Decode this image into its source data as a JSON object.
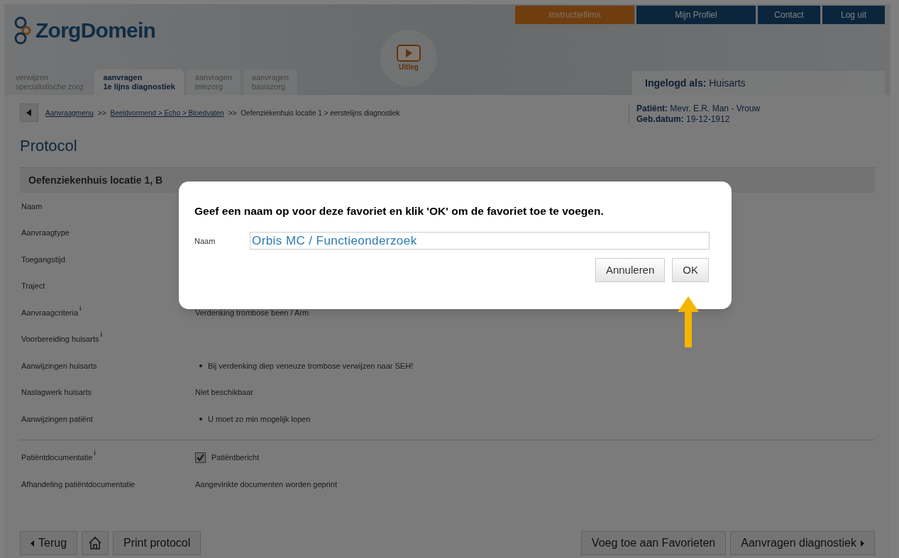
{
  "logo": {
    "text": "ZorgDomein"
  },
  "top_nav": [
    {
      "label": "Instructiefilms",
      "kind": "accent"
    },
    {
      "label": "Mijn Profiel",
      "kind": "primary"
    },
    {
      "label": "Contact",
      "kind": "primary"
    },
    {
      "label": "Log uit",
      "kind": "primary"
    }
  ],
  "help_video": {
    "label": "Uitleg"
  },
  "tabs": [
    {
      "line1": "verwijzen",
      "line2": "specialistische zorg",
      "kind": "plain",
      "selected": false
    },
    {
      "line1": "aanvragen",
      "line2": "1e lijns diagnostiek",
      "kind": "tab",
      "selected": true
    },
    {
      "line1": "aanvragen",
      "line2": "telezorg",
      "kind": "tab",
      "selected": false
    },
    {
      "line1": "aanvragen",
      "line2": "basiszorg",
      "kind": "tab",
      "selected": false
    }
  ],
  "logged_in": {
    "label": "Ingelogd als:",
    "value": "Huisarts"
  },
  "breadcrumb": [
    {
      "label": "Aanvraagmenu",
      "kind": "link"
    },
    {
      "label": ">>",
      "kind": "separator"
    },
    {
      "label": "Beeldvormend > Echo > Bloedvaten",
      "kind": "link"
    },
    {
      "label": ">>",
      "kind": "separator"
    },
    {
      "label": "Oefenziekenhuis locatie 1 > eerstelijns diagnostiek",
      "kind": "text"
    }
  ],
  "patient": {
    "name_label": "Patiënt:",
    "name": "Mevr. E.R. Man - Vrouw",
    "dob_label": "Geb.datum:",
    "dob": "19-12-1912"
  },
  "page_title": "Protocol",
  "section": {
    "title": "Oefenziekenhuis locatie 1, B"
  },
  "rows": [
    {
      "label": "Naam",
      "kind": "empty"
    },
    {
      "label": "Aanvraagtype",
      "kind": "empty"
    },
    {
      "label": "Toegangstijd",
      "kind": "empty"
    },
    {
      "label": "Traject",
      "kind": "empty"
    },
    {
      "label": "Aanvraagcriteria",
      "info_mark": "i",
      "kind": "text",
      "value": "Verdenking trombose been / Arm"
    },
    {
      "label": "Voorbereiding huisarts",
      "info_mark": "i",
      "kind": "empty"
    },
    {
      "label": "Aanwijzingen huisarts",
      "kind": "bullet",
      "value": "Bij verdenking diep veneuze trombose verwijzen naar SEH!"
    },
    {
      "label": "Naslagwerk huisarts",
      "kind": "text",
      "value": "Niet beschikbaar"
    },
    {
      "label": "Aanwijzingen patiënt",
      "kind": "bullet",
      "value": "U moet zo min mogelijk lopen"
    }
  ],
  "documentation_rows": [
    {
      "label": "Patiëntdocumentatie",
      "info_mark": "i",
      "kind": "checkbox",
      "value": "Patiëntbericht",
      "checked": true
    },
    {
      "label": "Afhandeling patiëntdocumentatie",
      "kind": "text",
      "value": "Aangevinkte documenten worden geprint"
    }
  ],
  "footer_left": [
    {
      "label": "Terug",
      "kind": "back"
    },
    {
      "kind": "home"
    },
    {
      "label": "Print protocol",
      "kind": "plain"
    }
  ],
  "footer_right": [
    {
      "label": "Voeg toe aan Favorieten",
      "kind": "plain"
    },
    {
      "label": "Aanvragen diagnostiek",
      "kind": "forward"
    }
  ],
  "dialog": {
    "title": "Geef een naam op voor deze favoriet en klik 'OK' om de favoriet toe te voegen.",
    "field_label": "Naam",
    "field_value": "Orbis MC / Functieonderzoek",
    "buttons": [
      {
        "label": "Annuleren"
      },
      {
        "label": "OK"
      }
    ]
  }
}
